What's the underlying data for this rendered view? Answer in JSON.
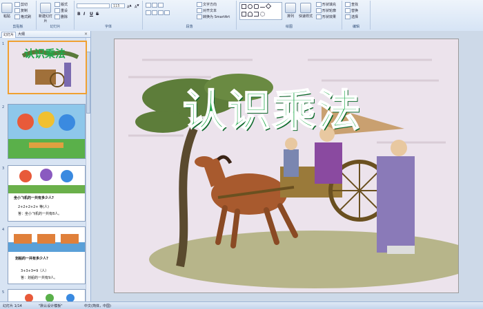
{
  "ribbon": {
    "groups": {
      "clipboard": "剪贴板",
      "slides": "幻灯片",
      "font": "字体",
      "paragraph": "段落",
      "drawing": "绘图",
      "editing": "编辑"
    },
    "clipboard": {
      "paste": "粘贴",
      "cut": "剪切",
      "copy": "复制",
      "format_painter": "格式刷"
    },
    "slides": {
      "new_slide": "新建幻灯片",
      "layout": "版式",
      "reset": "重设",
      "delete": "删除"
    },
    "font": {
      "size": "115",
      "bold": "B",
      "italic": "I",
      "underline": "U",
      "strike": "S"
    },
    "paragraph": {
      "text_direction": "文字方向",
      "align_text": "对齐文本",
      "smartart": "转换为 SmartArt"
    },
    "drawing": {
      "arrange": "排列",
      "quick_styles": "快速样式",
      "shape_fill": "形状填充",
      "shape_outline": "形状轮廓",
      "shape_effects": "形状效果"
    },
    "editing": {
      "find": "查找",
      "replace": "替换",
      "select": "选择"
    }
  },
  "panel": {
    "tabs": [
      "幻灯片",
      "大纲"
    ],
    "close": "×",
    "slides": [
      {
        "num": "1",
        "title": "认识乘法"
      },
      {
        "num": "2"
      },
      {
        "num": "3",
        "q": "坐小飞机的一共有多少人?",
        "eq": "2+2+2+2+ 等(人)",
        "label": "答：坐小飞机的一共有8人。"
      },
      {
        "num": "4",
        "q": "划船的一共有多少人?",
        "eq": "3+3+3=9（人）",
        "label": "答：划船的一共有9人。"
      },
      {
        "num": "5"
      }
    ]
  },
  "slide": {
    "title": "认识乘法"
  },
  "status": {
    "slide_pos": "幻灯片 1/14",
    "theme": "\"默认设计模板\"",
    "lang": "中文(简体，中国)"
  }
}
